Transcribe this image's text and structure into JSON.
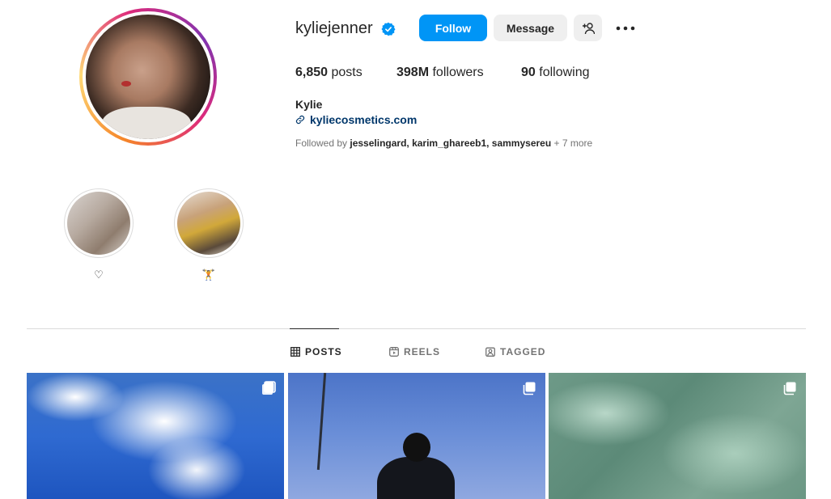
{
  "profile": {
    "username": "kyliejenner",
    "full_name": "Kylie",
    "website": "kyliecosmetics.com",
    "actions": {
      "follow_label": "Follow",
      "message_label": "Message"
    },
    "stats": {
      "posts_count": "6,850",
      "posts_label": "posts",
      "followers_count": "398M",
      "followers_label": "followers",
      "following_count": "90",
      "following_label": "following"
    },
    "followed_by": {
      "prefix": "Followed by",
      "names": "jesselingard, karim_ghareeb1, sammysereu",
      "more": "+ 7 more"
    }
  },
  "highlights": [
    {
      "label": "♡"
    },
    {
      "label": "🏋"
    }
  ],
  "tabs": [
    {
      "label": "POSTS",
      "icon": "grid-icon",
      "active": true
    },
    {
      "label": "REELS",
      "icon": "reels-icon",
      "active": false
    },
    {
      "label": "TAGGED",
      "icon": "tagged-icon",
      "active": false
    }
  ],
  "colors": {
    "follow_button": "#0095f6",
    "verified_badge": "#0095f6",
    "link": "#00376b"
  }
}
